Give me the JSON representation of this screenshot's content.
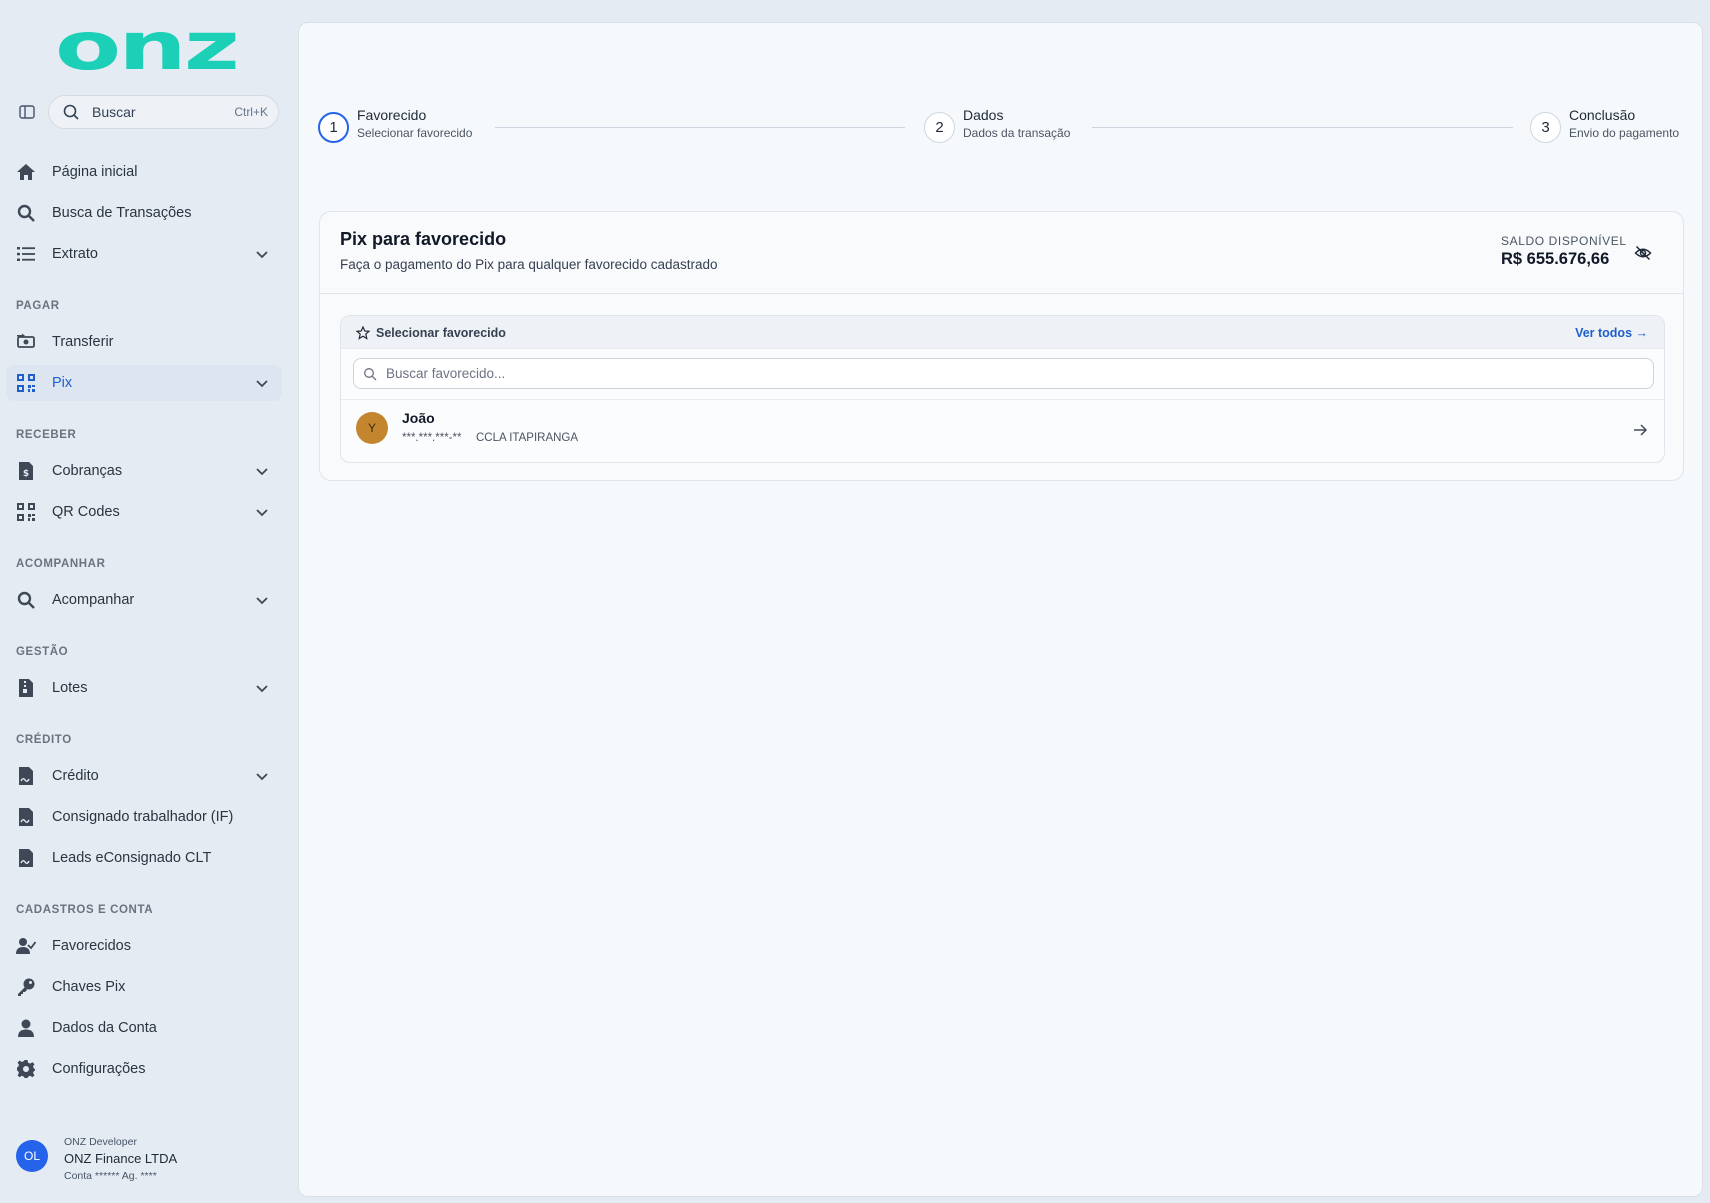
{
  "brand": {
    "logo_text": "onz",
    "color": "#1ccfb7",
    "accent": "#1f5fc9"
  },
  "search": {
    "placeholder": "Buscar",
    "shortcut": "Ctrl+K"
  },
  "nav": {
    "home": "Página inicial",
    "tx_search": "Busca de Transações",
    "statement": "Extrato",
    "sections": {
      "pay": "PAGAR",
      "receive": "RECEBER",
      "track": "ACOMPANHAR",
      "management": "GESTÃO",
      "credit": "CRÉDITO",
      "registry": "CADASTROS E CONTA"
    },
    "transfer": "Transferir",
    "pix": "Pix",
    "charges": "Cobranças",
    "qrcodes": "QR Codes",
    "track": "Acompanhar",
    "batches": "Lotes",
    "credit": "Crédito",
    "payroll": "Consignado trabalhador (IF)",
    "leads": "Leads eConsignado CLT",
    "favorites": "Favorecidos",
    "pix_keys": "Chaves Pix",
    "account": "Dados da Conta",
    "settings": "Configurações"
  },
  "user": {
    "initials": "OL",
    "role": "ONZ Developer",
    "company": "ONZ Finance LTDA",
    "account": "Conta ****** Ag. ****"
  },
  "stepper": [
    {
      "num": "1",
      "title": "Favorecido",
      "sub": "Selecionar favorecido",
      "active": true
    },
    {
      "num": "2",
      "title": "Dados",
      "sub": "Dados da transação",
      "active": false
    },
    {
      "num": "3",
      "title": "Conclusão",
      "sub": "Envio do pagamento",
      "active": false
    }
  ],
  "card": {
    "title": "Pix para favorecido",
    "description": "Faça o pagamento do Pix para qualquer favorecido cadastrado",
    "balance_label": "SALDO DISPONÍVEL",
    "balance_value": "R$ 655.676,66"
  },
  "favorites": {
    "header": "Selecionar favorecido",
    "see_all": "Ver todos →",
    "search_placeholder": "Buscar favorecido...",
    "items": [
      {
        "initial": "Y",
        "name": "João",
        "document": "***.***.***-**",
        "bank": "CCLA ITAPIRANGA"
      }
    ]
  }
}
